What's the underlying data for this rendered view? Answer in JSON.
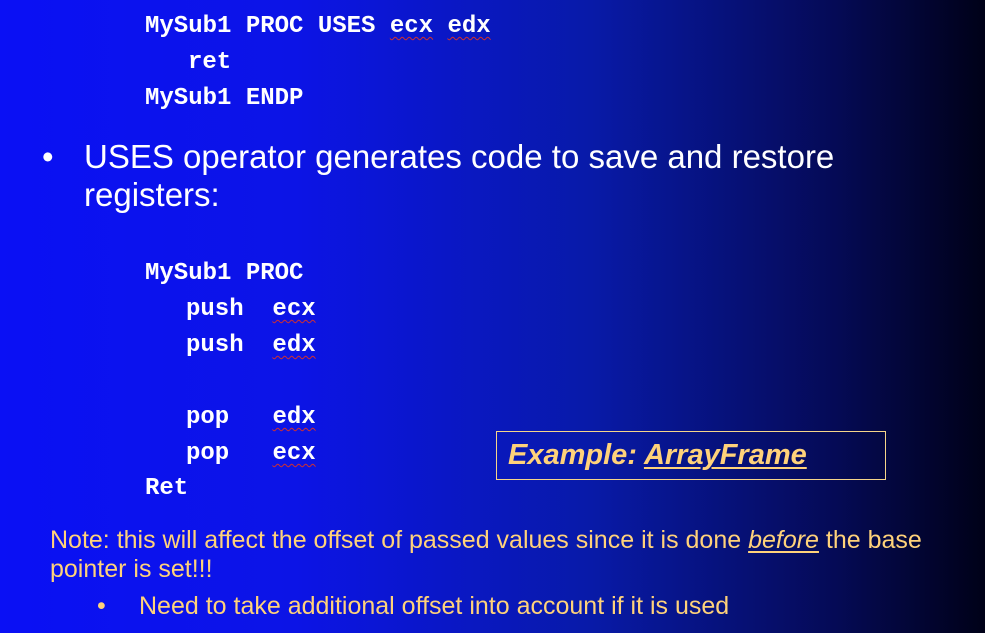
{
  "code_block_1": {
    "line1": {
      "proc_name": "MySub1",
      "kw_proc": "PROC",
      "kw_uses": "USES",
      "reg1": "ecx",
      "reg2": "edx"
    },
    "line2": {
      "instr": "ret"
    },
    "line3": {
      "proc_name": "MySub1",
      "kw_endp": "ENDP"
    }
  },
  "bullet": {
    "symbol": "•",
    "text": "USES operator generates code to save and restore registers:"
  },
  "code_block_2": {
    "header": {
      "proc_name": "MySub1",
      "kw_proc": "PROC"
    },
    "push1": {
      "instr": "push",
      "reg": "ecx"
    },
    "push2": {
      "instr": "push",
      "reg": "edx"
    },
    "pop1": {
      "instr": "pop",
      "reg": "edx"
    },
    "pop2": {
      "instr": "pop",
      "reg": "ecx"
    },
    "ret": {
      "instr": "Ret"
    }
  },
  "example": {
    "prefix": "Example: ",
    "link": "ArrayFrame"
  },
  "note": {
    "part1": "Note: this will affect the offset of passed values since it is done ",
    "emphasis": "before",
    "part2": " the base pointer is set!!!"
  },
  "sub_bullet": {
    "symbol": "•",
    "text": "Need to take additional offset into account if it is used"
  },
  "colors": {
    "code_text": "#ffffff",
    "note_text": "#ffd27a",
    "squiggle": "#d03030",
    "bg_left": "#0a10f5",
    "bg_right": "#000118"
  }
}
